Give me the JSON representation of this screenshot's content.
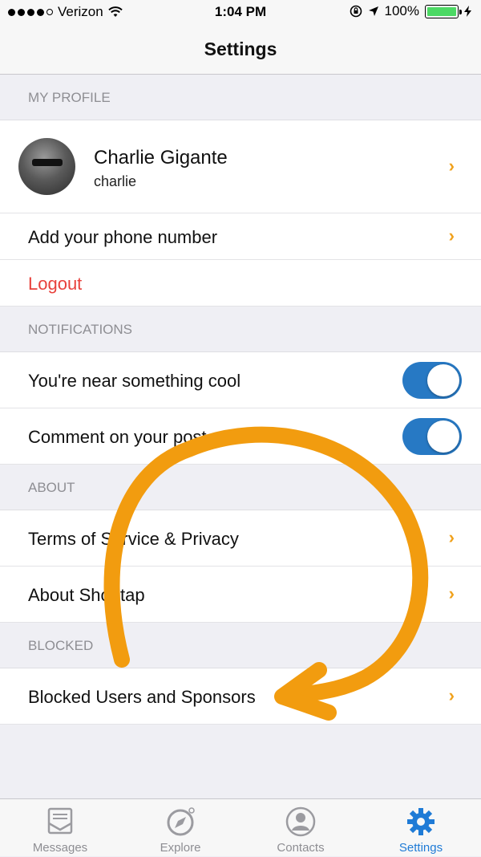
{
  "status_bar": {
    "carrier": "Verizon",
    "time": "1:04 PM",
    "battery": "100%",
    "battery_color": "#4cd964"
  },
  "nav": {
    "title": "Settings"
  },
  "sections": {
    "profile": {
      "header": "MY PROFILE"
    },
    "notifications": {
      "header": "NOTIFICATIONS"
    },
    "about": {
      "header": "ABOUT"
    },
    "blocked": {
      "header": "BLOCKED"
    }
  },
  "profile": {
    "name": "Charlie Gigante",
    "username": "charlie",
    "add_phone_label": "Add your phone number",
    "logout_label": "Logout",
    "logout_color": "#e8413c"
  },
  "notifications": {
    "near_label": "You're near something cool",
    "near_on": true,
    "comment_label": "Comment on your post",
    "comment_on": true,
    "toggle_color": "#2779c4"
  },
  "about": {
    "terms_label": "Terms of Service & Privacy",
    "about_label": "About Shoutap"
  },
  "blocked": {
    "blocked_label": "Blocked Users and Sponsors"
  },
  "accent_color": "#f0a11c",
  "annotation_arrow_color": "#f29c0f",
  "tabbar": {
    "messages": "Messages",
    "explore": "Explore",
    "contacts": "Contacts",
    "settings": "Settings",
    "active": "Settings",
    "active_color": "#1f7bd6"
  }
}
